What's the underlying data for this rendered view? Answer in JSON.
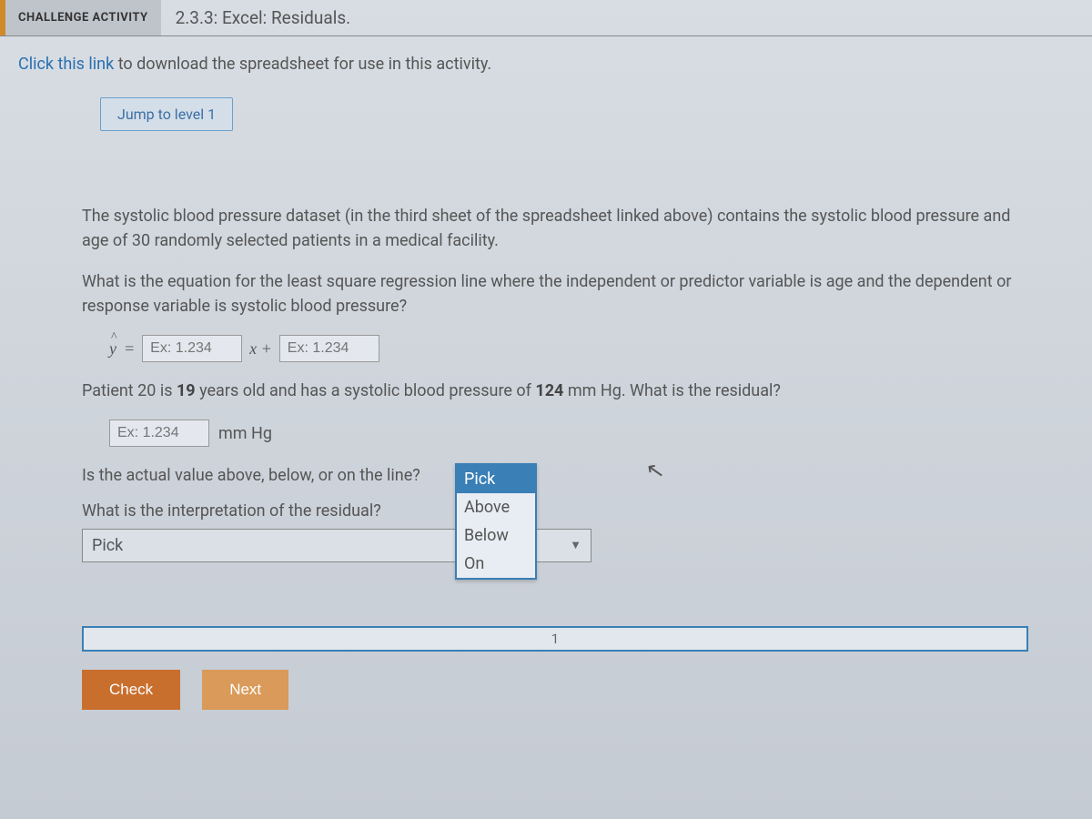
{
  "header": {
    "badge": "CHALLENGE ACTIVITY",
    "title": "2.3.3: Excel: Residuals."
  },
  "download": {
    "link_text": "Click this link",
    "rest": " to download the spreadsheet for use in this activity."
  },
  "jump": {
    "label": "Jump to level 1"
  },
  "body": {
    "intro": "The systolic blood pressure dataset (in the third sheet of the spreadsheet linked above) contains the systolic blood pressure and age of 30 randomly selected patients in a medical facility.",
    "q1": "What is the equation for the least square regression line where the independent or predictor variable is age and the dependent or response variable is systolic blood pressure?",
    "eq": {
      "yhat_eq": " = ",
      "placeholder": "Ex: 1.234",
      "xplus": "x + "
    },
    "patient": {
      "pre": "Patient 20 is ",
      "age": "19",
      "mid": " years old and has a systolic blood pressure of ",
      "bp": "124",
      "post": " mm Hg. What is the residual?"
    },
    "residual_unit": "mm Hg",
    "line_q": "Is the actual value above, below, or on the line?",
    "dropdown": {
      "selected": "Pick",
      "opt1": "Above",
      "opt2": "Below",
      "opt3": "On"
    },
    "interp_q": "What is the interpretation of the residual?",
    "interp_selected": "Pick"
  },
  "progress": {
    "step": "1"
  },
  "buttons": {
    "check": "Check",
    "next": "Next"
  }
}
